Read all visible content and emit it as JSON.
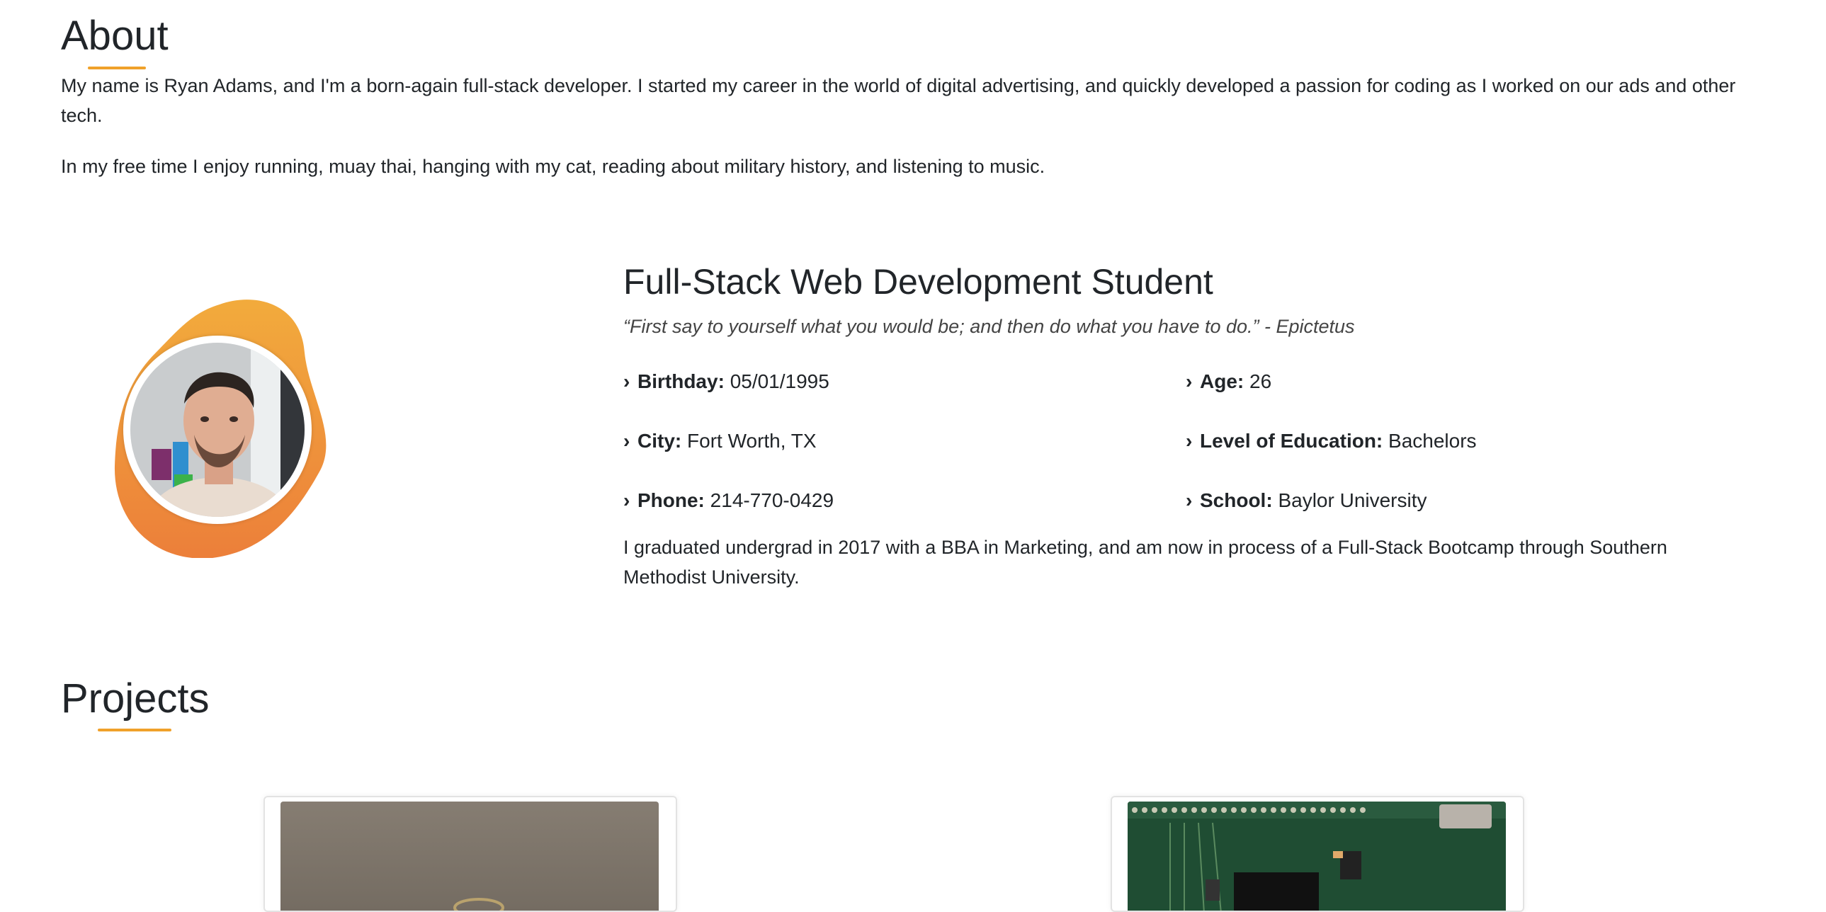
{
  "about": {
    "title": "About",
    "paragraph1": "My name is Ryan Adams, and I'm a born-again full-stack developer. I started my career in the world of digital advertising, and quickly developed a passion for coding as I worked on our ads and other tech.",
    "paragraph2": "In my free time I enjoy running, muay thai, hanging with my cat, reading about military history, and listening to music."
  },
  "profile": {
    "role_title": "Full-Stack Web Development Student",
    "quote": "“First say to yourself what you would be; and then do what you have to do.” - Epictetus",
    "details": [
      {
        "label": "Birthday:",
        "value": "05/01/1995"
      },
      {
        "label": "Age:",
        "value": "26"
      },
      {
        "label": "City:",
        "value": "Fort Worth, TX"
      },
      {
        "label": "Level of Education:",
        "value": "Bachelors"
      },
      {
        "label": "Phone:",
        "value": "214-770-0429"
      },
      {
        "label": "School:",
        "value": "Baylor University"
      }
    ],
    "summary": "I graduated undergrad in 2017 with a BBA in Marketing, and am now in process of a Full-Stack Bootcamp through Southern Methodist University.",
    "chevron_icon": "›"
  },
  "projects": {
    "title": "Projects"
  },
  "colors": {
    "accent": "#f0a12a",
    "blob_top": "#f2a83a",
    "blob_bottom": "#ee8438",
    "text": "#212529"
  }
}
